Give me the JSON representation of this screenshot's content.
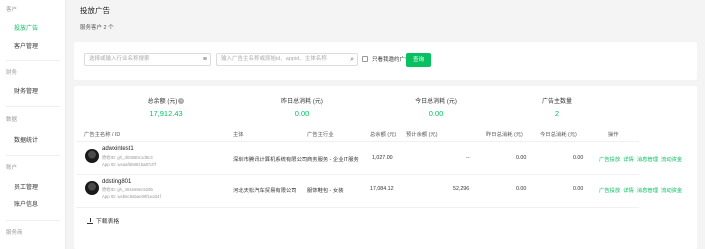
{
  "sidebar": {
    "group_customer": "客户",
    "item_ads": "投放广告",
    "item_customer_mgmt": "客户管理",
    "group_finance": "财务",
    "item_finance_mgmt": "财务管理",
    "group_data": "数据",
    "item_data_stats": "数据统计",
    "group_account": "账户",
    "item_staff_mgmt": "员工管理",
    "item_account_info": "账户信息",
    "group_service": "服务商"
  },
  "header": {
    "title": "投放广告",
    "service_label": "服务客户",
    "service_count": "2 个"
  },
  "filters": {
    "industry_placeholder": "选择或输入行业名称搜索",
    "search_placeholder": "输入广告主名称或原始id、appid、主体名称",
    "only_mine_label": "只看我邀约广告主",
    "query_button": "查询"
  },
  "stats": [
    {
      "label": "总余额 (元)",
      "value": "17,912.43"
    },
    {
      "label": "昨日总消耗 (元)",
      "value": "0.00"
    },
    {
      "label": "今日总消耗 (元)",
      "value": "0.00"
    },
    {
      "label": "广告主数量",
      "value": "2"
    }
  ],
  "table": {
    "headers": [
      "广告主名称 / ID",
      "主体",
      "广告主行业",
      "总余额 (元)",
      "预计余额 (元)",
      "昨日总消耗 (元)",
      "今日总消耗 (元)",
      "操作"
    ],
    "rows": [
      {
        "name": "adwxintest1",
        "orig_id": "原始ID: gh_d03680c1d9c3",
        "app_id": "App ID: wxaaf6b8815a87d7f",
        "entity": "深圳市腾讯计算机系统有限公司",
        "industry": "商务服务 - 企业IT服务",
        "balance": "1,027.00",
        "est_balance": "--",
        "yesterday": "0.00",
        "today": "0.00"
      },
      {
        "name": "ddsting801",
        "orig_id": "原始ID: gh_404e69ec529b",
        "app_id": "App ID: wxb6c9abae09f1ea34f",
        "entity": "河北天松汽车贸易有限公司",
        "industry": "服饰鞋包 - 女装",
        "balance": "17,084.12",
        "est_balance": "52,296",
        "yesterday": "0.00",
        "today": "0.00"
      }
    ],
    "actions": [
      "广告投放",
      "详情",
      "消息管理",
      "流动资金"
    ]
  },
  "download_label": "下载表格"
}
